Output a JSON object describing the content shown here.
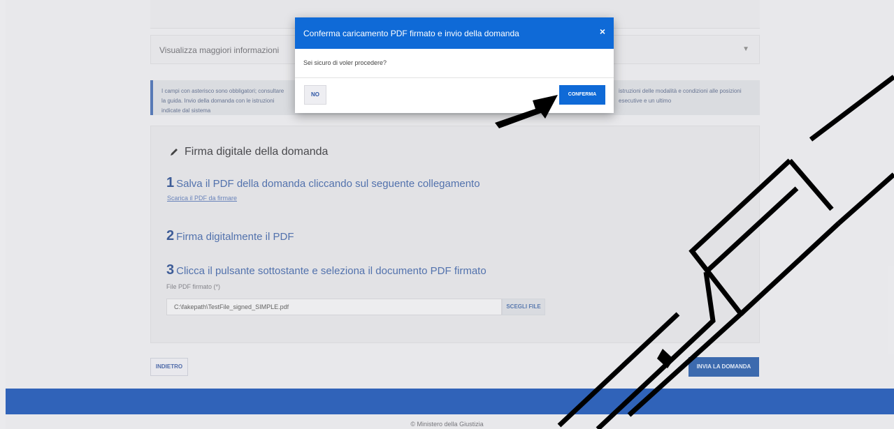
{
  "page": {
    "accordion_label": "Visualizza maggiori informazioni",
    "info_text_left": "I campi con asterisco sono obbligatori; consultare la guida. Invio della domanda con le istruzioni indicate dal sistema",
    "info_text_right": "istruzioni delle modalità e condizioni alle posizioni esecutive e un ultimo",
    "sign_section_title": "Firma digitale della domanda",
    "step1_number": "1",
    "step1_text": "Salva il PDF della domanda cliccando sul seguente collegamento",
    "step1_link": "Scarica il PDF da firmare",
    "step2_number": "2",
    "step2_text": "Firma digitalmente il PDF",
    "step3_number": "3",
    "step3_text": "Clicca il pulsante sottostante e seleziona il documento PDF firmato",
    "file_label": "File PDF firmato (*)",
    "file_value": "C:\\fakepath\\TestFile_signed_SIMPLE.pdf",
    "choose_file_label": "SCEGLI FILE",
    "back_button": "INDIETRO",
    "send_button": "INVIA LA DOMANDA",
    "copyright": "© Ministero della Giustizia"
  },
  "modal": {
    "title": "Conferma caricamento PDF firmato e invio della domanda",
    "close_symbol": "×",
    "message": "Sei sicuro di voler procedere?",
    "no_label": "NO",
    "confirm_label": "CONFERMA"
  },
  "colors": {
    "primary": "#0f6ad7",
    "footer": "#1f56b4",
    "watermark": "#000000"
  }
}
